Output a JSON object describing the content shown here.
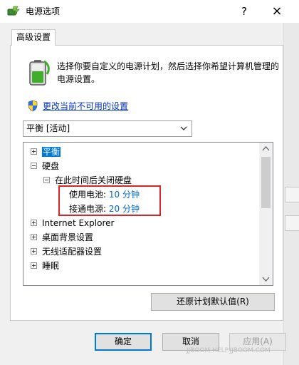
{
  "window": {
    "title": "电源选项",
    "help_label": "?",
    "close_label": "×"
  },
  "tab": {
    "label": "高级设置"
  },
  "description": "选择你要自定义的电源计划，然后选择你希望计算机管理的电源设置。",
  "change_link": "更改当前不可用的设置",
  "plan_select": {
    "value": "平衡 [活动]"
  },
  "tree": {
    "rows": [
      {
        "label": "平衡",
        "expander": "plus",
        "selected": true
      },
      {
        "label": "硬盘",
        "expander": "minus"
      },
      {
        "label": "在此时间后关闭硬盘",
        "expander": "minus"
      },
      {
        "label": "使用电池:",
        "value": "10 分钟"
      },
      {
        "label": "接通电源:",
        "value": "20 分钟"
      },
      {
        "label": "Internet Explorer",
        "expander": "plus"
      },
      {
        "label": "桌面背景设置",
        "expander": "plus"
      },
      {
        "label": "无线适配器设置",
        "expander": "plus"
      },
      {
        "label": "睡眠",
        "expander": "plus"
      }
    ]
  },
  "buttons": {
    "restore": "还原计划默认值(R)",
    "ok": "确定",
    "cancel": "取消",
    "apply": "应用(A)"
  },
  "watermark": "JJBOOM HELP.JJBOOM.COM",
  "colors": {
    "selection": "#0078d7",
    "link": "#0033cc",
    "value": "#0066cc",
    "highlight_box": "#d9262b"
  }
}
